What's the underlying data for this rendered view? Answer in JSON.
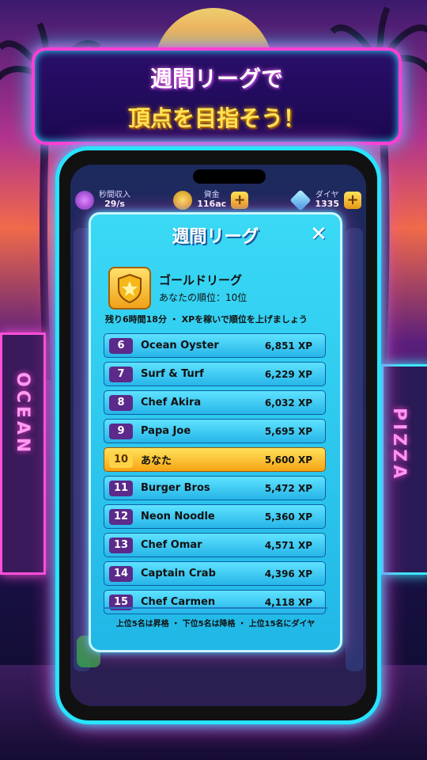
{
  "banner": {
    "line1": "週間リーグで",
    "line2": "頂点を目指そう！"
  },
  "stats": {
    "income_label": "秒間収入",
    "income_value": "29/s",
    "funds_label": "資金",
    "funds_value": "116ac",
    "diamond_label": "ダイヤ",
    "diamond_value": "1335",
    "plus": "+"
  },
  "modal": {
    "title": "週間リーグ",
    "close": "✕",
    "league_name": "ゴールドリーグ",
    "your_rank": "あなたの順位：10位",
    "timer": "残り6時間18分 ・ XPを稼いで順位を上げましょう",
    "footer": "上位5名は昇格 ・ 下位5名は降格 ・ 上位15名にダイヤ"
  },
  "leaderboard": [
    {
      "rank": "6",
      "name": "Ocean Oyster",
      "xp": "6,851 XP"
    },
    {
      "rank": "7",
      "name": "Surf & Turf",
      "xp": "6,229 XP"
    },
    {
      "rank": "8",
      "name": "Chef Akira",
      "xp": "6,032 XP"
    },
    {
      "rank": "9",
      "name": "Papa Joe",
      "xp": "5,695 XP"
    },
    {
      "rank": "10",
      "name": "あなた",
      "xp": "5,600 XP",
      "highlight": true
    },
    {
      "rank": "11",
      "name": "Burger Bros",
      "xp": "5,472 XP"
    },
    {
      "rank": "12",
      "name": "Neon Noodle",
      "xp": "5,360 XP"
    },
    {
      "rank": "13",
      "name": "Chef Omar",
      "xp": "4,571 XP"
    },
    {
      "rank": "14",
      "name": "Captain Crab",
      "xp": "4,396 XP"
    },
    {
      "rank": "15",
      "name": "Chef Carmen",
      "xp": "4,118 XP"
    }
  ],
  "signs": {
    "left": "OCEAN",
    "right": "PIZZA"
  },
  "colors": {
    "neon_pink": "#ff3fd6",
    "neon_cyan": "#27e4ff",
    "gold": "#ffd347",
    "modal_bg": "#3ad9f5"
  }
}
